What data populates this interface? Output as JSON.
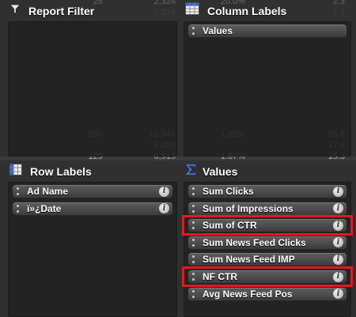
{
  "background_sheet": {
    "rows": [
      [
        "28",
        "2,324",
        "20.0%",
        "2.3"
      ],
      [
        "",
        "2,324",
        "",
        "2.3"
      ],
      [
        "",
        "",
        "",
        ""
      ],
      [
        "",
        "",
        "",
        ""
      ],
      [
        "",
        "",
        "",
        ""
      ],
      [
        "",
        "",
        "",
        ""
      ],
      [
        "",
        "",
        "",
        ""
      ],
      [
        "",
        "",
        "",
        ""
      ],
      [
        "",
        "",
        "",
        ""
      ],
      [
        "",
        "",
        "",
        ""
      ],
      [
        "",
        "",
        "",
        ""
      ],
      [
        "",
        "",
        "",
        ""
      ],
      [
        "236",
        "12,941",
        "1.82%",
        "15.5"
      ],
      [
        "",
        "5,083",
        "",
        "17.3"
      ],
      [
        "129",
        "6,915",
        "1.87%",
        "15.3"
      ]
    ]
  },
  "quadrants": {
    "report_filter": {
      "title": "Report Filter",
      "icon": "funnel-icon"
    },
    "column_labels": {
      "title": "Column Labels",
      "icon": "table-columns-icon",
      "items": [
        {
          "label": "Values"
        }
      ]
    },
    "row_labels": {
      "title": "Row Labels",
      "icon": "table-rows-icon",
      "items": [
        {
          "label": "Ad Name"
        },
        {
          "label": "ï»¿Date"
        }
      ]
    },
    "values": {
      "title": "Values",
      "icon": "sigma-icon",
      "items": [
        {
          "label": "Sum Clicks",
          "highlighted": false
        },
        {
          "label": "Sum of Impressions",
          "highlighted": false
        },
        {
          "label": "Sum of CTR",
          "highlighted": true
        },
        {
          "label": "Sum News Feed Clicks",
          "highlighted": false
        },
        {
          "label": "Sum News Feed IMP",
          "highlighted": false
        },
        {
          "label": "NF CTR",
          "highlighted": true
        },
        {
          "label": "Avg News Feed Pos",
          "highlighted": false
        }
      ]
    }
  },
  "info_glyph": "i",
  "colors": {
    "highlight": "#e8161e",
    "pill_top": "#5d5d5d",
    "pill_bottom": "#3c3c3c",
    "panel": "#3a3a3a"
  }
}
